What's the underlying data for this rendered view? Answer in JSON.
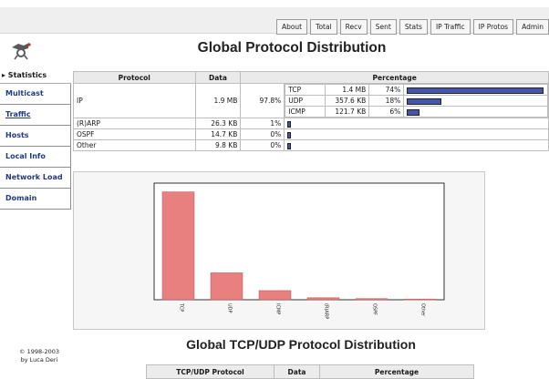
{
  "nav_tabs": [
    "About",
    "Total",
    "Recv",
    "Sent",
    "Stats",
    "IP Traffic",
    "IP Protos",
    "Admin"
  ],
  "page_title": "Global Protocol Distribution",
  "sidebar": {
    "header": "▸ Statistics",
    "items": [
      "Multicast",
      "Traffic",
      "Hosts",
      "Local Info",
      "Network Load",
      "Domain"
    ],
    "active": "Traffic"
  },
  "copyright": [
    "© 1998-2003",
    "by Luca Deri"
  ],
  "protocol_table": {
    "headers": [
      "Protocol",
      "Data",
      "Percentage"
    ],
    "ip": {
      "name": "IP",
      "data": "1.9 MB",
      "pct": "97.8%",
      "sub": [
        {
          "name": "TCP",
          "data": "1.4 MB",
          "pct": "74%",
          "fraction": 0.74
        },
        {
          "name": "UDP",
          "data": "357.6 KB",
          "pct": "18%",
          "fraction": 0.18
        },
        {
          "name": "ICMP",
          "data": "121.7 KB",
          "pct": "6%",
          "fraction": 0.06
        }
      ]
    },
    "rows": [
      {
        "name": "(R)ARP",
        "data": "26.3 KB",
        "pct": "1%",
        "fraction": 0.01
      },
      {
        "name": "OSPF",
        "data": "14.7 KB",
        "pct": "0%",
        "fraction": 0.0
      },
      {
        "name": "Other",
        "data": "9.8 KB",
        "pct": "0%",
        "fraction": 0.0
      }
    ]
  },
  "chart_data": {
    "type": "bar",
    "categories": [
      "TCP",
      "UDP",
      "ICMP",
      "(R)ARP",
      "OSPF",
      "Other"
    ],
    "values": [
      1433.6,
      357.6,
      121.7,
      26.3,
      14.7,
      9.8
    ],
    "ylim": [
      0,
      1550
    ],
    "bar_color": "#e88080",
    "grid": false
  },
  "subtitle": "Global TCP/UDP Protocol Distribution",
  "tcp_table": {
    "headers": [
      "TCP/UDP Protocol",
      "Data",
      "Percentage"
    ]
  }
}
